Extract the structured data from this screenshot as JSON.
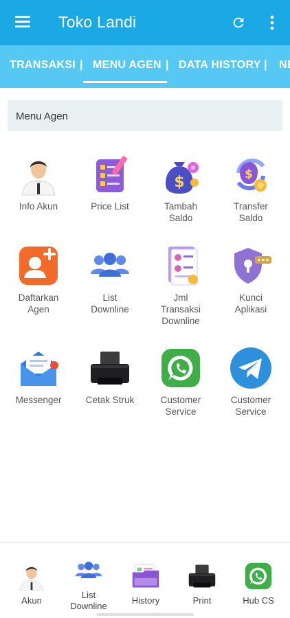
{
  "appbar": {
    "title": "Toko Landi"
  },
  "tabs": [
    {
      "label": "TRANSAKSI"
    },
    {
      "label": "MENU AGEN"
    },
    {
      "label": "DATA HISTORY"
    },
    {
      "label": "NE"
    }
  ],
  "section": {
    "title": "Menu Agen"
  },
  "menu": [
    {
      "label": "Info Akun",
      "icon": "user-avatar-icon"
    },
    {
      "label": "Price List",
      "icon": "price-list-icon"
    },
    {
      "label": "Tambah\nSaldo",
      "icon": "money-bag-icon"
    },
    {
      "label": "Transfer\nSaldo",
      "icon": "coin-transfer-icon"
    },
    {
      "label": "Daftarkan\nAgen",
      "icon": "add-user-icon"
    },
    {
      "label": "List\nDownline",
      "icon": "group-users-icon"
    },
    {
      "label": "Jml\nTransaksi\nDownline",
      "icon": "transaction-report-icon"
    },
    {
      "label": "Kunci\nAplikasi",
      "icon": "shield-lock-icon"
    },
    {
      "label": "Messenger",
      "icon": "envelope-icon"
    },
    {
      "label": "Cetak Struk",
      "icon": "printer-icon"
    },
    {
      "label": "Customer\nService",
      "icon": "whatsapp-icon"
    },
    {
      "label": "Customer\nService",
      "icon": "telegram-icon"
    }
  ],
  "bottom_nav": [
    {
      "label": "Akun",
      "icon": "user-avatar-icon"
    },
    {
      "label": "List\nDownline",
      "icon": "group-users-icon"
    },
    {
      "label": "History",
      "icon": "history-folder-icon"
    },
    {
      "label": "Print",
      "icon": "printer-icon"
    },
    {
      "label": "Hub CS",
      "icon": "whatsapp-icon"
    }
  ],
  "colors": {
    "primary": "#1ba9e5",
    "tab_bar": "#56c8f4",
    "section_bg": "#e9f0f2"
  }
}
